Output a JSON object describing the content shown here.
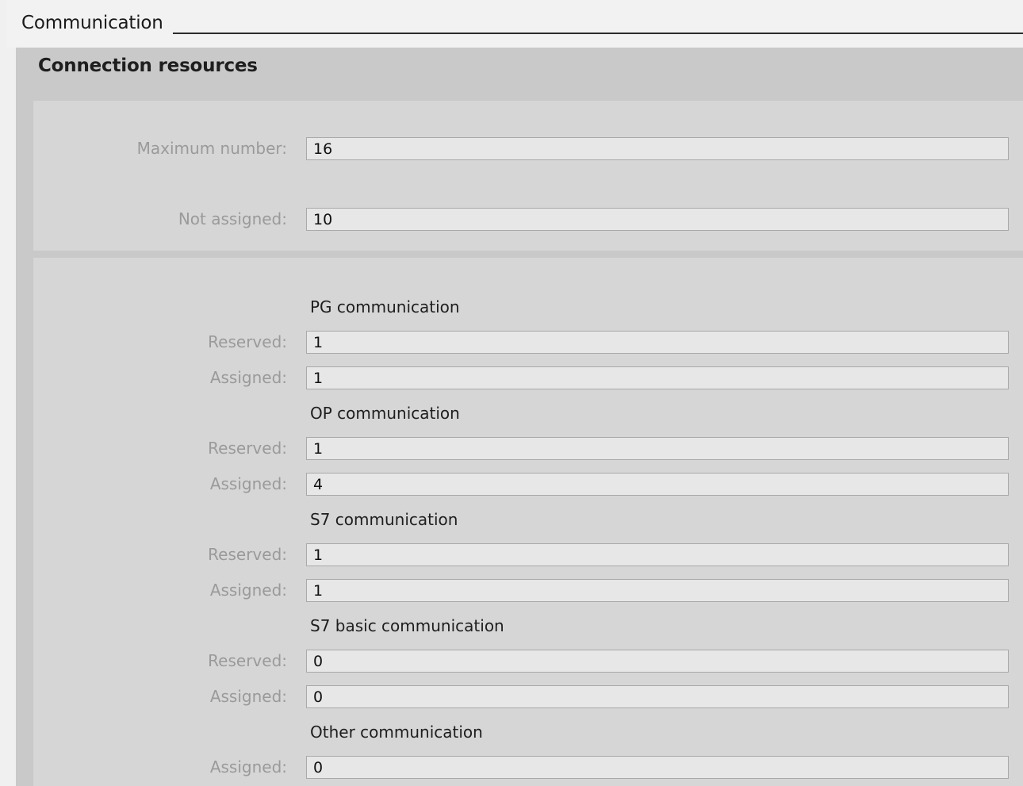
{
  "header": {
    "title": "Communication"
  },
  "section": {
    "title": "Connection resources"
  },
  "summary": {
    "maximum_number": {
      "label": "Maximum number:",
      "value": "16"
    },
    "not_assigned": {
      "label": "Not assigned:",
      "value": "10"
    }
  },
  "groups": [
    {
      "title": "PG communication",
      "reserved": {
        "label": "Reserved:",
        "value": "1"
      },
      "assigned": {
        "label": "Assigned:",
        "value": "1"
      }
    },
    {
      "title": "OP communication",
      "reserved": {
        "label": "Reserved:",
        "value": "1"
      },
      "assigned": {
        "label": "Assigned:",
        "value": "4"
      }
    },
    {
      "title": "S7 communication",
      "reserved": {
        "label": "Reserved:",
        "value": "1"
      },
      "assigned": {
        "label": "Assigned:",
        "value": "1"
      }
    },
    {
      "title": "S7 basic communication",
      "reserved": {
        "label": "Reserved:",
        "value": "0"
      },
      "assigned": {
        "label": "Assigned:",
        "value": "0"
      }
    },
    {
      "title": "Other communication",
      "assigned": {
        "label": "Assigned:",
        "value": "0"
      }
    }
  ]
}
